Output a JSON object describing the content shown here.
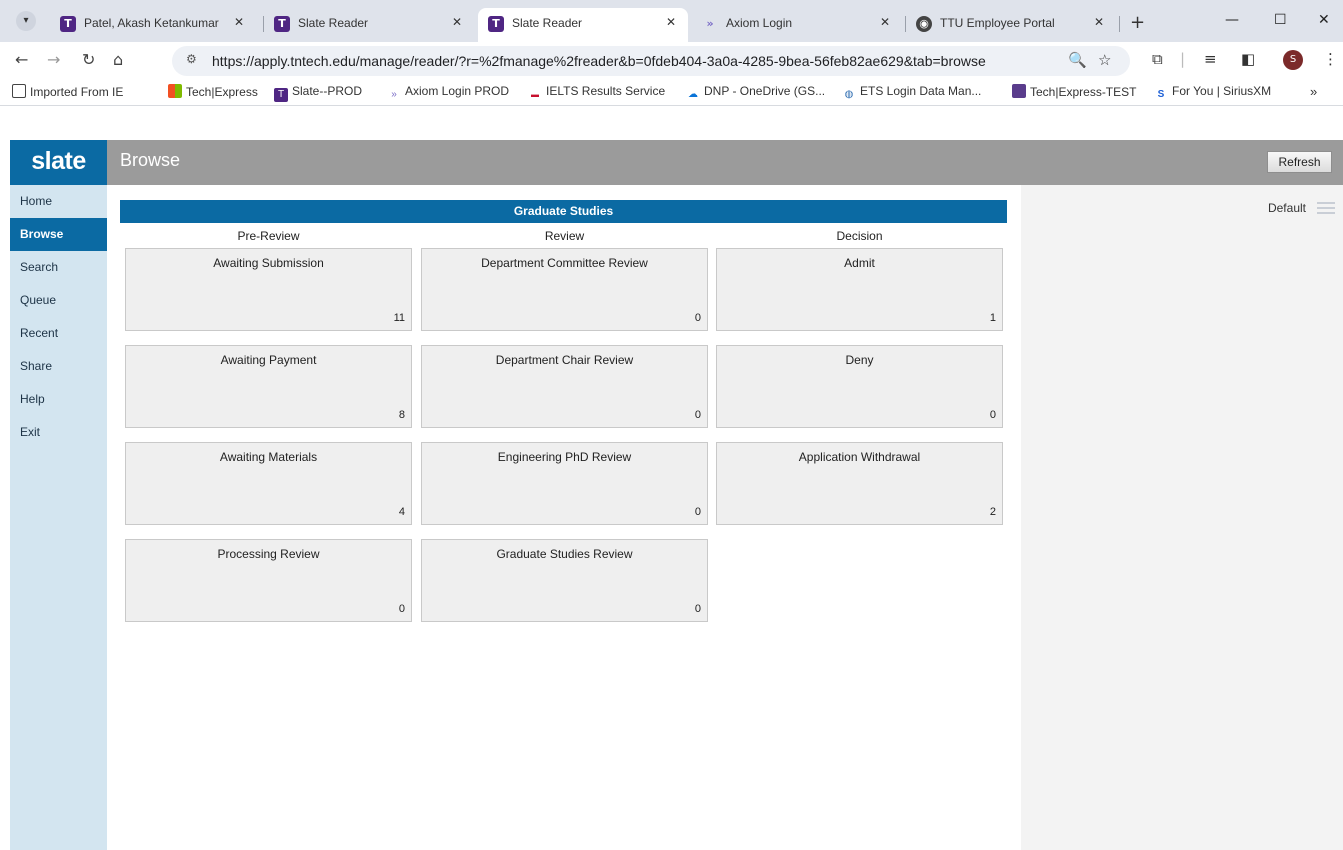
{
  "browser": {
    "tabs": [
      {
        "label": "Patel, Akash Ketankumar",
        "icon": "ttu-t-icon",
        "active": false
      },
      {
        "label": "Slate Reader",
        "icon": "ttu-t-icon",
        "active": false
      },
      {
        "label": "Slate Reader",
        "icon": "ttu-t-icon",
        "active": true
      },
      {
        "label": "Axiom Login",
        "icon": "axiom-icon",
        "active": false
      },
      {
        "label": "TTU Employee Portal",
        "icon": "globe-icon",
        "active": false
      }
    ],
    "url": "https://apply.tntech.edu/manage/reader/?r=%2fmanage%2freader&b=0fdeb404-3a0a-4285-9bea-56feb82ae629&tab=browse",
    "avatar_letter": "S",
    "bookmarks": [
      {
        "label": "Imported From IE",
        "icon": "folder-icon"
      },
      {
        "label": "Tech|Express",
        "icon": "microsoft-icon"
      },
      {
        "label": "Slate--PROD",
        "icon": "ttu-t-icon"
      },
      {
        "label": "Axiom Login PROD",
        "icon": "axiom-icon"
      },
      {
        "label": "IELTS Results Service",
        "icon": "ielts-icon"
      },
      {
        "label": "DNP - OneDrive (GS...",
        "icon": "onedrive-icon"
      },
      {
        "label": "ETS Login Data Man...",
        "icon": "ets-icon"
      },
      {
        "label": "Tech|Express-TEST",
        "icon": "tech-express-icon"
      },
      {
        "label": "For You | SiriusXM",
        "icon": "siriusxm-icon"
      }
    ]
  },
  "app": {
    "logo": "slate",
    "page_title": "Browse",
    "refresh_label": "Refresh",
    "nav": [
      {
        "label": "Home",
        "active": false
      },
      {
        "label": "Browse",
        "active": true
      },
      {
        "label": "Search",
        "active": false
      },
      {
        "label": "Queue",
        "active": false
      },
      {
        "label": "Recent",
        "active": false
      },
      {
        "label": "Share",
        "active": false
      },
      {
        "label": "Help",
        "active": false
      },
      {
        "label": "Exit",
        "active": false
      }
    ],
    "view_label": "Default",
    "board": {
      "title": "Graduate Studies",
      "columns": [
        {
          "heading": "Pre-Review",
          "bins": [
            {
              "title": "Awaiting Submission",
              "count": "11"
            },
            {
              "title": "Awaiting Payment",
              "count": "8"
            },
            {
              "title": "Awaiting Materials",
              "count": "4"
            },
            {
              "title": "Processing Review",
              "count": "0"
            }
          ]
        },
        {
          "heading": "Review",
          "bins": [
            {
              "title": "Department Committee Review",
              "count": "0"
            },
            {
              "title": "Department Chair Review",
              "count": "0"
            },
            {
              "title": "Engineering PhD Review",
              "count": "0"
            },
            {
              "title": "Graduate Studies Review",
              "count": "0"
            }
          ]
        },
        {
          "heading": "Decision",
          "bins": [
            {
              "title": "Admit",
              "count": "1"
            },
            {
              "title": "Deny",
              "count": "0"
            },
            {
              "title": "Application Withdrawal",
              "count": "2"
            }
          ]
        }
      ]
    },
    "colors": {
      "brand": "#0b6aa3",
      "header": "#9b9b9b",
      "sidebar": "#d3e5f0",
      "card": "#efefef"
    }
  }
}
